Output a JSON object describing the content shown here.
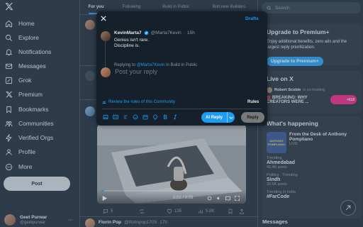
{
  "app": {
    "logo_icon": "x-logo-icon"
  },
  "sidebar": {
    "items": [
      {
        "label": "Home",
        "icon": "home-icon"
      },
      {
        "label": "Explore",
        "icon": "search-icon"
      },
      {
        "label": "Notifications",
        "icon": "bell-icon"
      },
      {
        "label": "Messages",
        "icon": "envelope-icon"
      },
      {
        "label": "Grok",
        "icon": "grok-icon"
      },
      {
        "label": "Premium",
        "icon": "x-logo-icon"
      },
      {
        "label": "Bookmarks",
        "icon": "bookmark-icon"
      },
      {
        "label": "Communities",
        "icon": "people-icon"
      },
      {
        "label": "Verified Orgs",
        "icon": "lightning-icon"
      },
      {
        "label": "Profile",
        "icon": "person-icon"
      },
      {
        "label": "More",
        "icon": "more-circle-icon"
      }
    ],
    "post_label": "Post",
    "profile": {
      "name": "Geet Purwar",
      "handle": "@geetpurwar",
      "more": "···"
    }
  },
  "feed": {
    "tabs": [
      "For you",
      "Following",
      "Build in Public",
      "Bolt.new Builders"
    ],
    "video": {
      "time": "0:02 / 0:05",
      "progress": 0.02
    },
    "actions": {
      "replies": "5",
      "reposts": "",
      "likes": "135",
      "views": "5.8K"
    },
    "bottom_post": {
      "name": "Florin Pop",
      "handle": "@florinpop1705",
      "time": "17h"
    }
  },
  "right": {
    "search_placeholder": "Search",
    "premium": {
      "title": "Upgrade to Premium+",
      "desc_line1": "Enjoy additional benefits, zero ads and the",
      "desc_line2": "largest reply prioritization.",
      "button": "Upgrade to Premium+"
    },
    "live": {
      "title": "Live on X",
      "host": "Robert Scoble",
      "host_suffix": "is co-hosting",
      "headline1": "BREAKING: WHY",
      "headline2": "CREATORS WERE ...",
      "count": "+618"
    },
    "happening": {
      "title": "What's happening",
      "feature_title1": "From the Desk of Anthony",
      "feature_title2": "Pompliano",
      "feature_tag": "LIVE",
      "feature_img_text": "ANTHONY POMPLIANO",
      "trends": [
        {
          "cat": "Trending",
          "name": "Ahmedabad",
          "count": "45.4K posts"
        },
        {
          "cat": "Politics · Trending",
          "name": "Sindh",
          "count": "30.6K posts"
        },
        {
          "cat": "Trending in India",
          "name": "#FarCode",
          "count": ""
        }
      ]
    },
    "messages_label": "Messages"
  },
  "modal": {
    "close_icon": "close-icon",
    "drafts": "Drafts",
    "original": {
      "name": "KevinMarta7",
      "handle": "@Marta7Kevin",
      "time": "15h",
      "line1": "Genius isn't rare.",
      "line2": "Discipline is."
    },
    "replying_prefix": "Replying to",
    "replying_mention": "@Marta7Kevin",
    "replying_suffix": "in Build in Public",
    "placeholder": "Post your reply",
    "review": "Review the rules of this Community",
    "rules": "Rules",
    "ai_reply": "AI Reply",
    "reply": "Reply",
    "toolbar_icons": [
      "image-icon",
      "gif-icon",
      "poll-icon",
      "emoji-icon",
      "schedule-icon",
      "location-icon",
      "bold-icon",
      "italic-icon"
    ]
  },
  "colors": {
    "accent": "#1d9bf0",
    "background": "#15202b",
    "border": "#38444d"
  }
}
